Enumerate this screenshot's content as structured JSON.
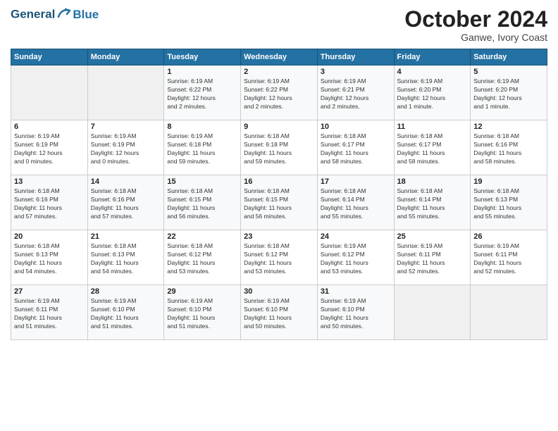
{
  "logo": {
    "line1": "General",
    "line2": "Blue"
  },
  "title": "October 2024",
  "subtitle": "Ganwe, Ivory Coast",
  "headers": [
    "Sunday",
    "Monday",
    "Tuesday",
    "Wednesday",
    "Thursday",
    "Friday",
    "Saturday"
  ],
  "weeks": [
    [
      {
        "day": "",
        "info": ""
      },
      {
        "day": "",
        "info": ""
      },
      {
        "day": "1",
        "info": "Sunrise: 6:19 AM\nSunset: 6:22 PM\nDaylight: 12 hours\nand 2 minutes."
      },
      {
        "day": "2",
        "info": "Sunrise: 6:19 AM\nSunset: 6:22 PM\nDaylight: 12 hours\nand 2 minutes."
      },
      {
        "day": "3",
        "info": "Sunrise: 6:19 AM\nSunset: 6:21 PM\nDaylight: 12 hours\nand 2 minutes."
      },
      {
        "day": "4",
        "info": "Sunrise: 6:19 AM\nSunset: 6:20 PM\nDaylight: 12 hours\nand 1 minute."
      },
      {
        "day": "5",
        "info": "Sunrise: 6:19 AM\nSunset: 6:20 PM\nDaylight: 12 hours\nand 1 minute."
      }
    ],
    [
      {
        "day": "6",
        "info": "Sunrise: 6:19 AM\nSunset: 6:19 PM\nDaylight: 12 hours\nand 0 minutes."
      },
      {
        "day": "7",
        "info": "Sunrise: 6:19 AM\nSunset: 6:19 PM\nDaylight: 12 hours\nand 0 minutes."
      },
      {
        "day": "8",
        "info": "Sunrise: 6:19 AM\nSunset: 6:18 PM\nDaylight: 11 hours\nand 59 minutes."
      },
      {
        "day": "9",
        "info": "Sunrise: 6:18 AM\nSunset: 6:18 PM\nDaylight: 11 hours\nand 59 minutes."
      },
      {
        "day": "10",
        "info": "Sunrise: 6:18 AM\nSunset: 6:17 PM\nDaylight: 11 hours\nand 58 minutes."
      },
      {
        "day": "11",
        "info": "Sunrise: 6:18 AM\nSunset: 6:17 PM\nDaylight: 11 hours\nand 58 minutes."
      },
      {
        "day": "12",
        "info": "Sunrise: 6:18 AM\nSunset: 6:16 PM\nDaylight: 11 hours\nand 58 minutes."
      }
    ],
    [
      {
        "day": "13",
        "info": "Sunrise: 6:18 AM\nSunset: 6:16 PM\nDaylight: 11 hours\nand 57 minutes."
      },
      {
        "day": "14",
        "info": "Sunrise: 6:18 AM\nSunset: 6:16 PM\nDaylight: 11 hours\nand 57 minutes."
      },
      {
        "day": "15",
        "info": "Sunrise: 6:18 AM\nSunset: 6:15 PM\nDaylight: 11 hours\nand 56 minutes."
      },
      {
        "day": "16",
        "info": "Sunrise: 6:18 AM\nSunset: 6:15 PM\nDaylight: 11 hours\nand 56 minutes."
      },
      {
        "day": "17",
        "info": "Sunrise: 6:18 AM\nSunset: 6:14 PM\nDaylight: 11 hours\nand 55 minutes."
      },
      {
        "day": "18",
        "info": "Sunrise: 6:18 AM\nSunset: 6:14 PM\nDaylight: 11 hours\nand 55 minutes."
      },
      {
        "day": "19",
        "info": "Sunrise: 6:18 AM\nSunset: 6:13 PM\nDaylight: 11 hours\nand 55 minutes."
      }
    ],
    [
      {
        "day": "20",
        "info": "Sunrise: 6:18 AM\nSunset: 6:13 PM\nDaylight: 11 hours\nand 54 minutes."
      },
      {
        "day": "21",
        "info": "Sunrise: 6:18 AM\nSunset: 6:13 PM\nDaylight: 11 hours\nand 54 minutes."
      },
      {
        "day": "22",
        "info": "Sunrise: 6:18 AM\nSunset: 6:12 PM\nDaylight: 11 hours\nand 53 minutes."
      },
      {
        "day": "23",
        "info": "Sunrise: 6:18 AM\nSunset: 6:12 PM\nDaylight: 11 hours\nand 53 minutes."
      },
      {
        "day": "24",
        "info": "Sunrise: 6:19 AM\nSunset: 6:12 PM\nDaylight: 11 hours\nand 53 minutes."
      },
      {
        "day": "25",
        "info": "Sunrise: 6:19 AM\nSunset: 6:11 PM\nDaylight: 11 hours\nand 52 minutes."
      },
      {
        "day": "26",
        "info": "Sunrise: 6:19 AM\nSunset: 6:11 PM\nDaylight: 11 hours\nand 52 minutes."
      }
    ],
    [
      {
        "day": "27",
        "info": "Sunrise: 6:19 AM\nSunset: 6:11 PM\nDaylight: 11 hours\nand 51 minutes."
      },
      {
        "day": "28",
        "info": "Sunrise: 6:19 AM\nSunset: 6:10 PM\nDaylight: 11 hours\nand 51 minutes."
      },
      {
        "day": "29",
        "info": "Sunrise: 6:19 AM\nSunset: 6:10 PM\nDaylight: 11 hours\nand 51 minutes."
      },
      {
        "day": "30",
        "info": "Sunrise: 6:19 AM\nSunset: 6:10 PM\nDaylight: 11 hours\nand 50 minutes."
      },
      {
        "day": "31",
        "info": "Sunrise: 6:19 AM\nSunset: 6:10 PM\nDaylight: 11 hours\nand 50 minutes."
      },
      {
        "day": "",
        "info": ""
      },
      {
        "day": "",
        "info": ""
      }
    ]
  ]
}
